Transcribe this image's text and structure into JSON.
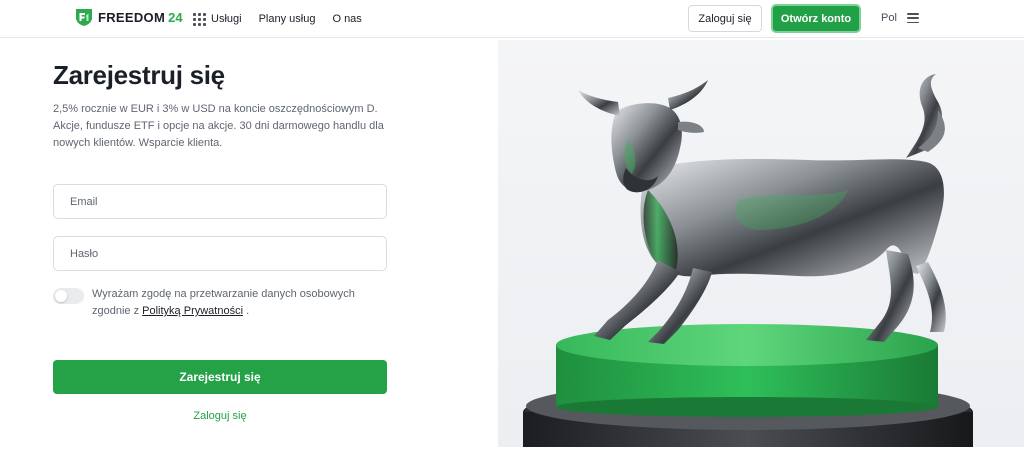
{
  "header": {
    "logo": {
      "text": "FREEDOM",
      "number": "24",
      "brand_color": "#2fa84f"
    },
    "nav": [
      {
        "label": "Usługi",
        "icon": "grid-icon"
      },
      {
        "label": "Plany usług"
      },
      {
        "label": "O nas"
      }
    ],
    "login_label": "Zaloguj się",
    "open_account_label": "Otwórz konto",
    "language": "Pol",
    "menu_icon": "hamburger-menu-icon"
  },
  "form": {
    "title": "Zarejestruj się",
    "subtitle": "2,5% rocznie w EUR i 3% w USD na koncie oszczędnościowym D. Akcje, fundusze ETF i opcje na akcje. 30 dni darmowego handlu dla nowych klientów. Wsparcie klienta.",
    "email": {
      "placeholder": "Email",
      "value": ""
    },
    "password": {
      "placeholder": "Hasło",
      "value": ""
    },
    "consent": {
      "enabled": false,
      "text_before": "Wyrażam zgodę na przetwarzanie danych osobowych zgodnie z ",
      "link_text": "Polityką Prywatności",
      "text_after": " ."
    },
    "submit_label": "Zarejestruj się",
    "login_link": "Zaloguj się"
  },
  "hero": {
    "image": "silver-bull-statue-on-green-pedestal",
    "accent_color": "#2fbf5a"
  },
  "colors": {
    "primary_green": "#22a047",
    "text_dark": "#1b1f27",
    "text_muted": "#5f6670"
  }
}
